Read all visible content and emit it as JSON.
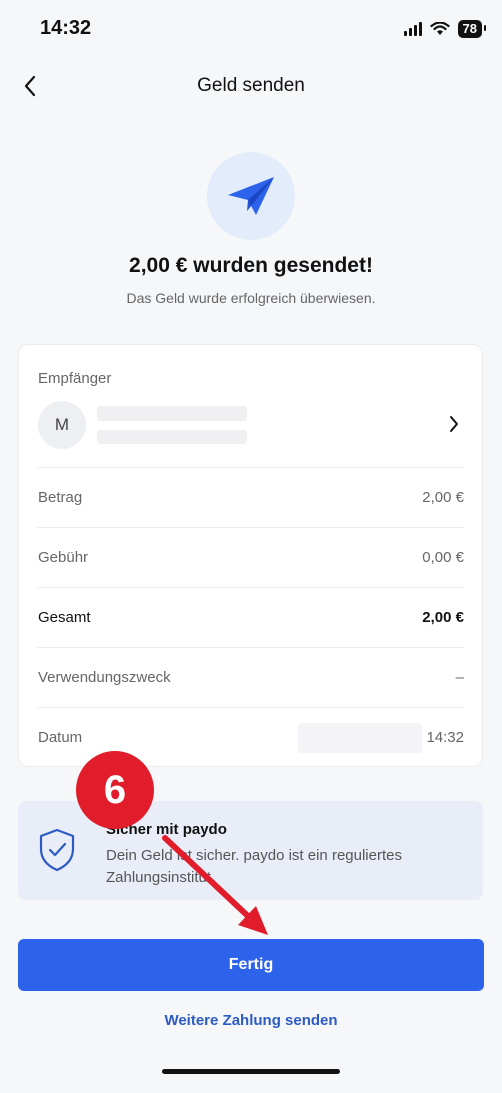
{
  "status_bar": {
    "time": "14:32",
    "battery": "78"
  },
  "header": {
    "title": "Geld senden"
  },
  "hero": {
    "icon": "paper-plane-icon",
    "headline": "2,00 € wurden gesendet!",
    "subline": "Das Geld wurde erfolgreich überwiesen."
  },
  "details": {
    "recipient_label": "Empfänger",
    "recipient_initial": "M",
    "rows": [
      {
        "label": "Betrag",
        "value": "2,00 €"
      },
      {
        "label": "Gebühr",
        "value": "0,00 €"
      },
      {
        "label": "Gesamt",
        "value": "2,00 €"
      },
      {
        "label": "Verwendungszweck",
        "value": "–"
      },
      {
        "label": "Datum",
        "value": "14:32"
      }
    ]
  },
  "security": {
    "title": "Sicher mit paydo",
    "text": "Dein Geld ist sicher. paydo ist ein reguliertes Zahlungsinstitut."
  },
  "actions": {
    "primary": "Fertig",
    "secondary": "Weitere Zahlung senden"
  },
  "annotation": {
    "step": "6"
  },
  "colors": {
    "accent": "#2d62ea",
    "annotation": "#e21d2b"
  }
}
